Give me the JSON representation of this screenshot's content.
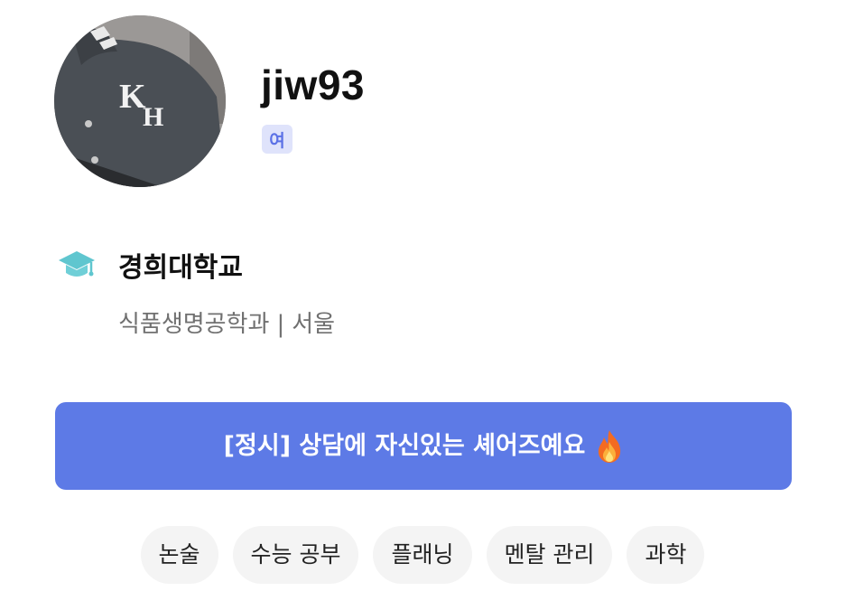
{
  "profile": {
    "username": "jiw93",
    "gender_badge": "여",
    "avatar_icon": "profile-photo-varsity-jacket-kh"
  },
  "school": {
    "icon": "graduation-cap-icon",
    "name": "경희대학교",
    "major": "식품생명공학과",
    "separator": "|",
    "region": "서울"
  },
  "banner": {
    "text": "[정시] 상담에 자신있는 셰어즈예요",
    "emoji_icon": "fire-icon",
    "color": "#5d7ae6"
  },
  "tags": [
    "논술",
    "수능 공부",
    "플래닝",
    "멘탈 관리",
    "과학"
  ],
  "colors": {
    "accent": "#5d7ae6",
    "badge_bg": "#dfe3fb",
    "badge_text": "#5b71e6",
    "school_icon": "#5fc6cf"
  }
}
